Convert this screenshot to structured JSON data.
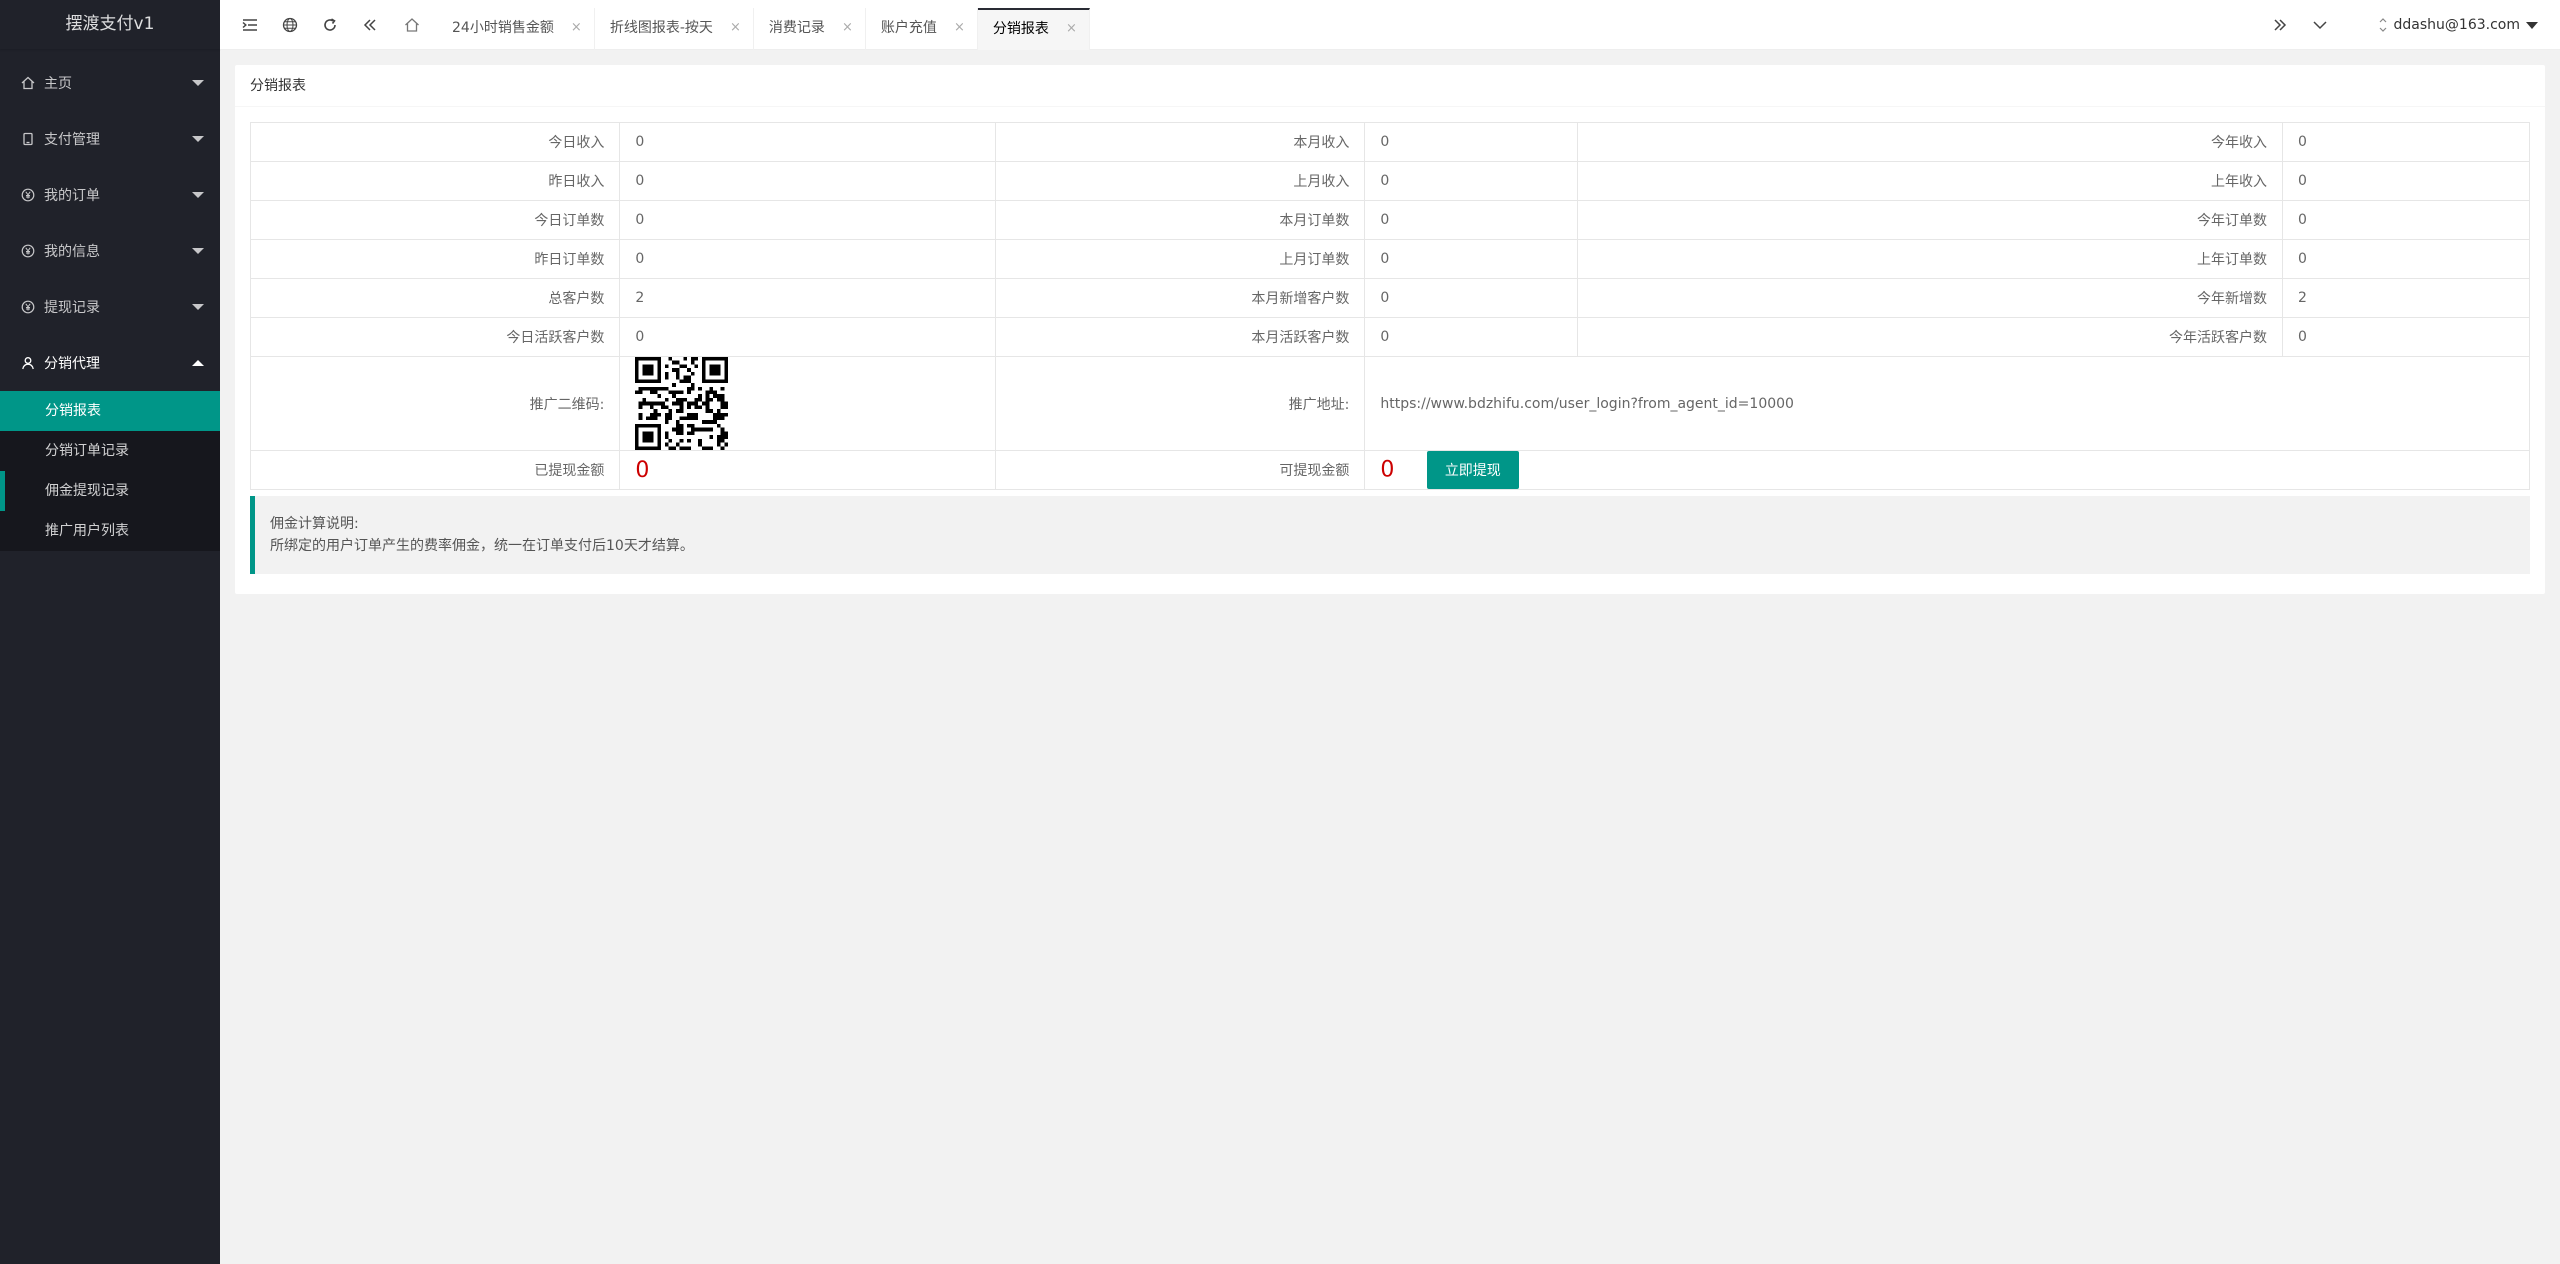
{
  "app": {
    "title": "摆渡支付v1"
  },
  "sidebar": {
    "items": [
      {
        "label": "主页",
        "icon": "home-icon"
      },
      {
        "label": "支付管理",
        "icon": "card-icon"
      },
      {
        "label": "我的订单",
        "icon": "yen-icon"
      },
      {
        "label": "我的信息",
        "icon": "yen-icon"
      },
      {
        "label": "提现记录",
        "icon": "yen-icon"
      },
      {
        "label": "分销代理",
        "icon": "user-icon"
      }
    ],
    "sub_items": [
      {
        "label": "分销报表"
      },
      {
        "label": "分销订单记录"
      },
      {
        "label": "佣金提现记录"
      },
      {
        "label": "推广用户列表"
      }
    ]
  },
  "tabs": [
    {
      "label": "24小时销售金额",
      "close": "×"
    },
    {
      "label": "折线图报表-按天",
      "close": "×"
    },
    {
      "label": "消费记录",
      "close": "×"
    },
    {
      "label": "账户充值",
      "close": "×"
    },
    {
      "label": "分销报表",
      "close": "×"
    }
  ],
  "user": {
    "email": "ddashu@163.com"
  },
  "page": {
    "title": "分销报表",
    "rows": [
      [
        {
          "label": "今日收入",
          "value": "0"
        },
        {
          "label": "本月收入",
          "value": "0"
        },
        {
          "label": "今年收入",
          "value": "0"
        }
      ],
      [
        {
          "label": "昨日收入",
          "value": "0"
        },
        {
          "label": "上月收入",
          "value": "0"
        },
        {
          "label": "上年收入",
          "value": "0"
        }
      ],
      [
        {
          "label": "今日订单数",
          "value": "0"
        },
        {
          "label": "本月订单数",
          "value": "0"
        },
        {
          "label": "今年订单数",
          "value": "0"
        }
      ],
      [
        {
          "label": "昨日订单数",
          "value": "0"
        },
        {
          "label": "上月订单数",
          "value": "0"
        },
        {
          "label": "上年订单数",
          "value": "0"
        }
      ],
      [
        {
          "label": "总客户数",
          "value": "2"
        },
        {
          "label": "本月新增客户数",
          "value": "0"
        },
        {
          "label": "今年新增数",
          "value": "2"
        }
      ],
      [
        {
          "label": "今日活跃客户数",
          "value": "0"
        },
        {
          "label": "本月活跃客户数",
          "value": "0"
        },
        {
          "label": "今年活跃客户数",
          "value": "0"
        }
      ]
    ],
    "qr_label": "推广二维码:",
    "promo_label": "推广地址:",
    "promo_url": "https://www.bdzhifu.com/user_login?from_agent_id=10000",
    "withdrawn_label": "已提现金额",
    "withdrawn_value": "0",
    "available_label": "可提现金额",
    "available_value": "0",
    "withdraw_button": "立即提现",
    "note_title": "佣金计算说明:",
    "note_text": "所绑定的用户订单产生的费率佣金，统一在订单支付后10天才结算。"
  },
  "colors": {
    "accent": "#009688",
    "sidebar_bg": "#20222a",
    "amount": "#cc0000"
  }
}
